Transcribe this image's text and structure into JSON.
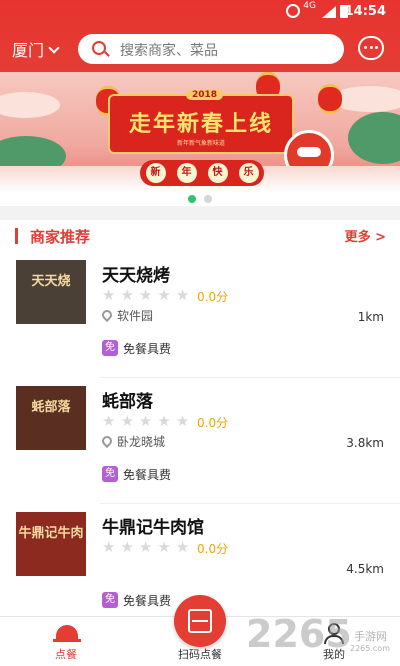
{
  "status_bar": {
    "time": "14:54",
    "network": "4G"
  },
  "header": {
    "city": "厦门",
    "search_placeholder": "搜索商家、菜品"
  },
  "banner": {
    "year": "2018",
    "title": "走年新春上线",
    "subtitle": "新年新气象新味道",
    "ribbon": [
      "新",
      "年",
      "快",
      "乐"
    ],
    "slide_count": 2,
    "active_slide": 0
  },
  "section": {
    "title": "商家推荐",
    "more": "更多 >"
  },
  "merchants": [
    {
      "name": "天天烧烤",
      "thumb_sign": "天天烧",
      "rating": 0,
      "score": "0.0分",
      "location": "软件园",
      "distance": "1km",
      "badge": "免",
      "tag": "免餐具费"
    },
    {
      "name": "蚝部落",
      "thumb_sign": "蚝部落",
      "rating": 0,
      "score": "0.0分",
      "location": "卧龙晓城",
      "distance": "3.8km",
      "badge": "免",
      "tag": "免餐具费"
    },
    {
      "name": "牛鼎记牛肉馆",
      "thumb_sign": "牛鼎记牛肉",
      "rating": 0,
      "score": "0.0分",
      "location": "",
      "distance": "4.5km",
      "badge": "免",
      "tag": "免餐具费"
    }
  ],
  "tabbar": {
    "order": "点餐",
    "scan": "扫码点餐",
    "mine": "我的"
  },
  "watermark": {
    "number": "2265",
    "text": "手游网",
    "domain": "2265.com"
  },
  "colors": {
    "primary": "#e33d34",
    "score": "#f0a500",
    "badge": "#b35fd6",
    "dot_active": "#37c06a"
  }
}
